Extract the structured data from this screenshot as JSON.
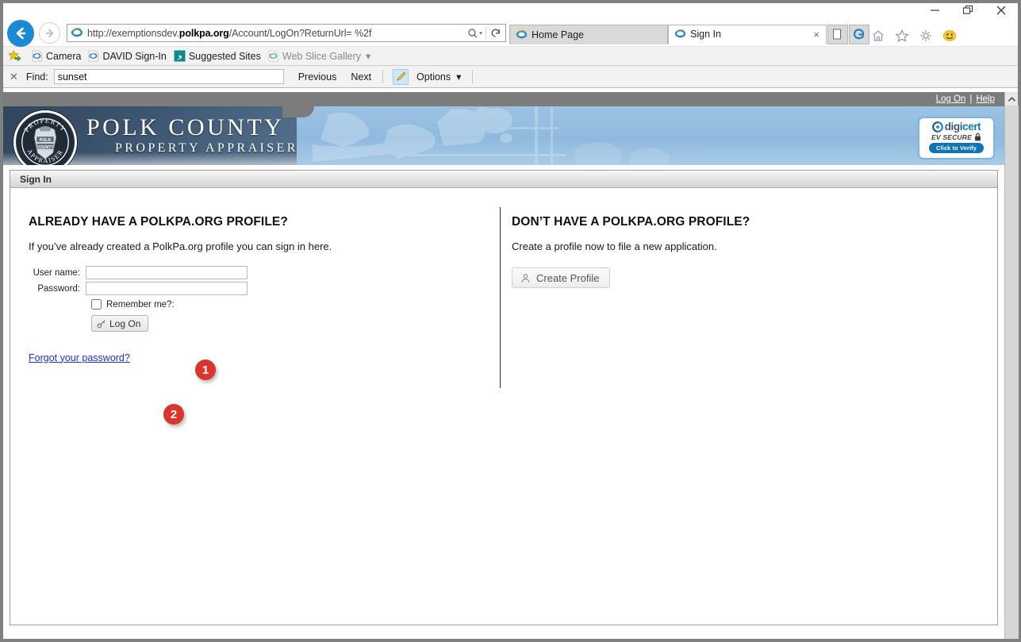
{
  "browser": {
    "window_controls": [
      "minimize",
      "restore",
      "close"
    ],
    "back_label": "Back",
    "forward_label": "Forward",
    "address": {
      "url_prefix": "http://exemptionsdev.",
      "url_domain": "polkpa.org",
      "url_suffix": "/Account/LogOn?ReturnUrl= %2f",
      "full_url": "http://exemptionsdev.polkpa.org/Account/LogOn?ReturnUrl= %2f",
      "search_icon": "search-icon",
      "refresh_icon": "refresh-icon"
    },
    "tabs": [
      {
        "label": "Home Page",
        "active": false,
        "closable": false
      },
      {
        "label": "Sign In",
        "active": true,
        "closable": true,
        "close_label": "×"
      }
    ],
    "tab_buttons": [
      {
        "name": "new-tab-button",
        "label": ""
      },
      {
        "name": "new-inprivate-tab-button",
        "label": ""
      }
    ],
    "tool_icons": [
      "home-icon",
      "favorites-star-icon",
      "gear-icon",
      "smiley-feedback-icon"
    ],
    "favorites_bar": [
      {
        "label": "",
        "icon": "add-to-favorites-icon",
        "dim": false
      },
      {
        "label": "Camera",
        "icon": "ie-page-icon",
        "dim": false
      },
      {
        "label": "DAVID Sign-In",
        "icon": "ie-page-icon",
        "dim": false
      },
      {
        "label": "Suggested Sites",
        "icon": "bing-icon",
        "dim": false
      },
      {
        "label": "Web Slice Gallery",
        "icon": "ie-page-icon",
        "dim": true,
        "caret": "▾"
      }
    ],
    "find_bar": {
      "close_label": "✕",
      "label": "Find:",
      "value": "sunset",
      "placeholder": "",
      "previous_label": "Previous",
      "next_label": "Next",
      "highlight_icon": "highlighter-pencil-icon",
      "options_label": "Options",
      "options_caret": "▾"
    }
  },
  "site": {
    "top_links": [
      {
        "label": "Log On"
      },
      {
        "label": "Help"
      }
    ],
    "top_separator": "|",
    "banner": {
      "title_line1": "POLK COUNTY",
      "title_line2": "PROPERTY APPRAISER",
      "seal_outer_top": "PROPERTY",
      "seal_outer_bottom": "APPRAISER",
      "seal_inner_line1": "POLK",
      "seal_inner_line2": "COUNTY"
    },
    "digicert": {
      "brand_part1": "digi",
      "brand_part2": "cert",
      "tagline": "EV SECURE",
      "lock_icon": "lock-icon",
      "verify_label": "Click to Verify"
    },
    "colors": {
      "banner_light_blue": "#97bfe0",
      "banner_dark_navy": "#31465c",
      "topbar_gray": "#7c7c7c",
      "accent_link": "#1a2fd6",
      "callout_red": "#d9352c",
      "digicert_blue": "#0d7ac4"
    }
  },
  "panel": {
    "header_title": "Sign In",
    "left": {
      "heading": "ALREADY HAVE A POLKPA.ORG PROFILE?",
      "subtext": "If you’ve already created a PolkPa.org profile you can sign in here.",
      "fields": [
        {
          "label": "User name:",
          "value": "",
          "placeholder": "",
          "type": "text",
          "name": "username-input"
        },
        {
          "label": "Password:",
          "value": "",
          "placeholder": "",
          "type": "password",
          "name": "password-input"
        }
      ],
      "remember_label": "Remember me?:",
      "remember_checked": false,
      "logon_button": "Log On",
      "logon_icon": "key-icon",
      "forgot_link": "Forgot your password?"
    },
    "right": {
      "heading": "DON’T HAVE A POLKPA.ORG PROFILE?",
      "subtext": "Create a profile now to file a new application.",
      "create_button": "Create Profile",
      "create_icon": "person-icon"
    }
  },
  "callouts": [
    {
      "number": "1",
      "target": "username-password-fields"
    },
    {
      "number": "2",
      "target": "log-on-button"
    }
  ],
  "scrollbar": {
    "up_arrow": "⌃",
    "orientation": "vertical"
  }
}
